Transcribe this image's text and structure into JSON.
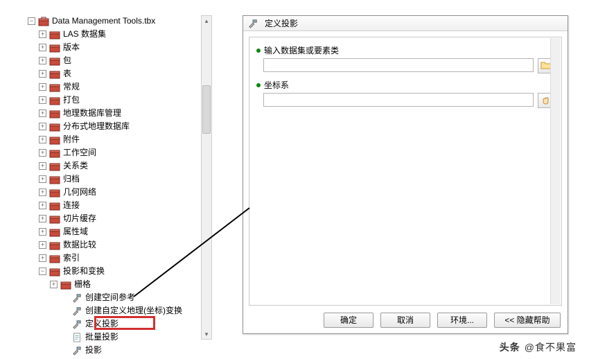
{
  "tree": {
    "root": {
      "label": "Data Management Tools.tbx",
      "glyph": "-"
    },
    "toolsets": [
      {
        "label": "LAS 数据集",
        "glyph": "+"
      },
      {
        "label": "版本",
        "glyph": "+"
      },
      {
        "label": "包",
        "glyph": "+"
      },
      {
        "label": "表",
        "glyph": "+"
      },
      {
        "label": "常规",
        "glyph": "+"
      },
      {
        "label": "打包",
        "glyph": "+"
      },
      {
        "label": "地理数据库管理",
        "glyph": "+"
      },
      {
        "label": "分布式地理数据库",
        "glyph": "+"
      },
      {
        "label": "附件",
        "glyph": "+"
      },
      {
        "label": "工作空间",
        "glyph": "+"
      },
      {
        "label": "关系类",
        "glyph": "+"
      },
      {
        "label": "归档",
        "glyph": "+"
      },
      {
        "label": "几何网络",
        "glyph": "+"
      },
      {
        "label": "连接",
        "glyph": "+"
      },
      {
        "label": "切片缓存",
        "glyph": "+"
      },
      {
        "label": "属性域",
        "glyph": "+"
      },
      {
        "label": "数据比较",
        "glyph": "+"
      },
      {
        "label": "索引",
        "glyph": "+"
      },
      {
        "label": "投影和变换",
        "glyph": "-"
      }
    ],
    "proj_children": [
      {
        "type": "toolset",
        "label": "栅格",
        "glyph": "+"
      },
      {
        "type": "hammer",
        "label": "创建空间参考",
        "glyph": ""
      },
      {
        "type": "hammer",
        "label": "创建自定义地理(坐标)变换",
        "glyph": ""
      },
      {
        "type": "hammer",
        "label": "定义投影",
        "glyph": "",
        "highlight": true
      },
      {
        "type": "script",
        "label": "批量投影",
        "glyph": ""
      },
      {
        "type": "hammer",
        "label": "投影",
        "glyph": ""
      }
    ]
  },
  "dialog": {
    "title": "定义投影",
    "params": [
      {
        "label": "输入数据集或要素类",
        "browse": "folder"
      },
      {
        "label": "坐标系",
        "browse": "hand"
      }
    ],
    "buttons": {
      "ok": "确定",
      "cancel": "取消",
      "env": "环境...",
      "help": "<< 隐藏帮助"
    }
  },
  "footer": {
    "prefix": "头条",
    "author": "@食不果富"
  }
}
